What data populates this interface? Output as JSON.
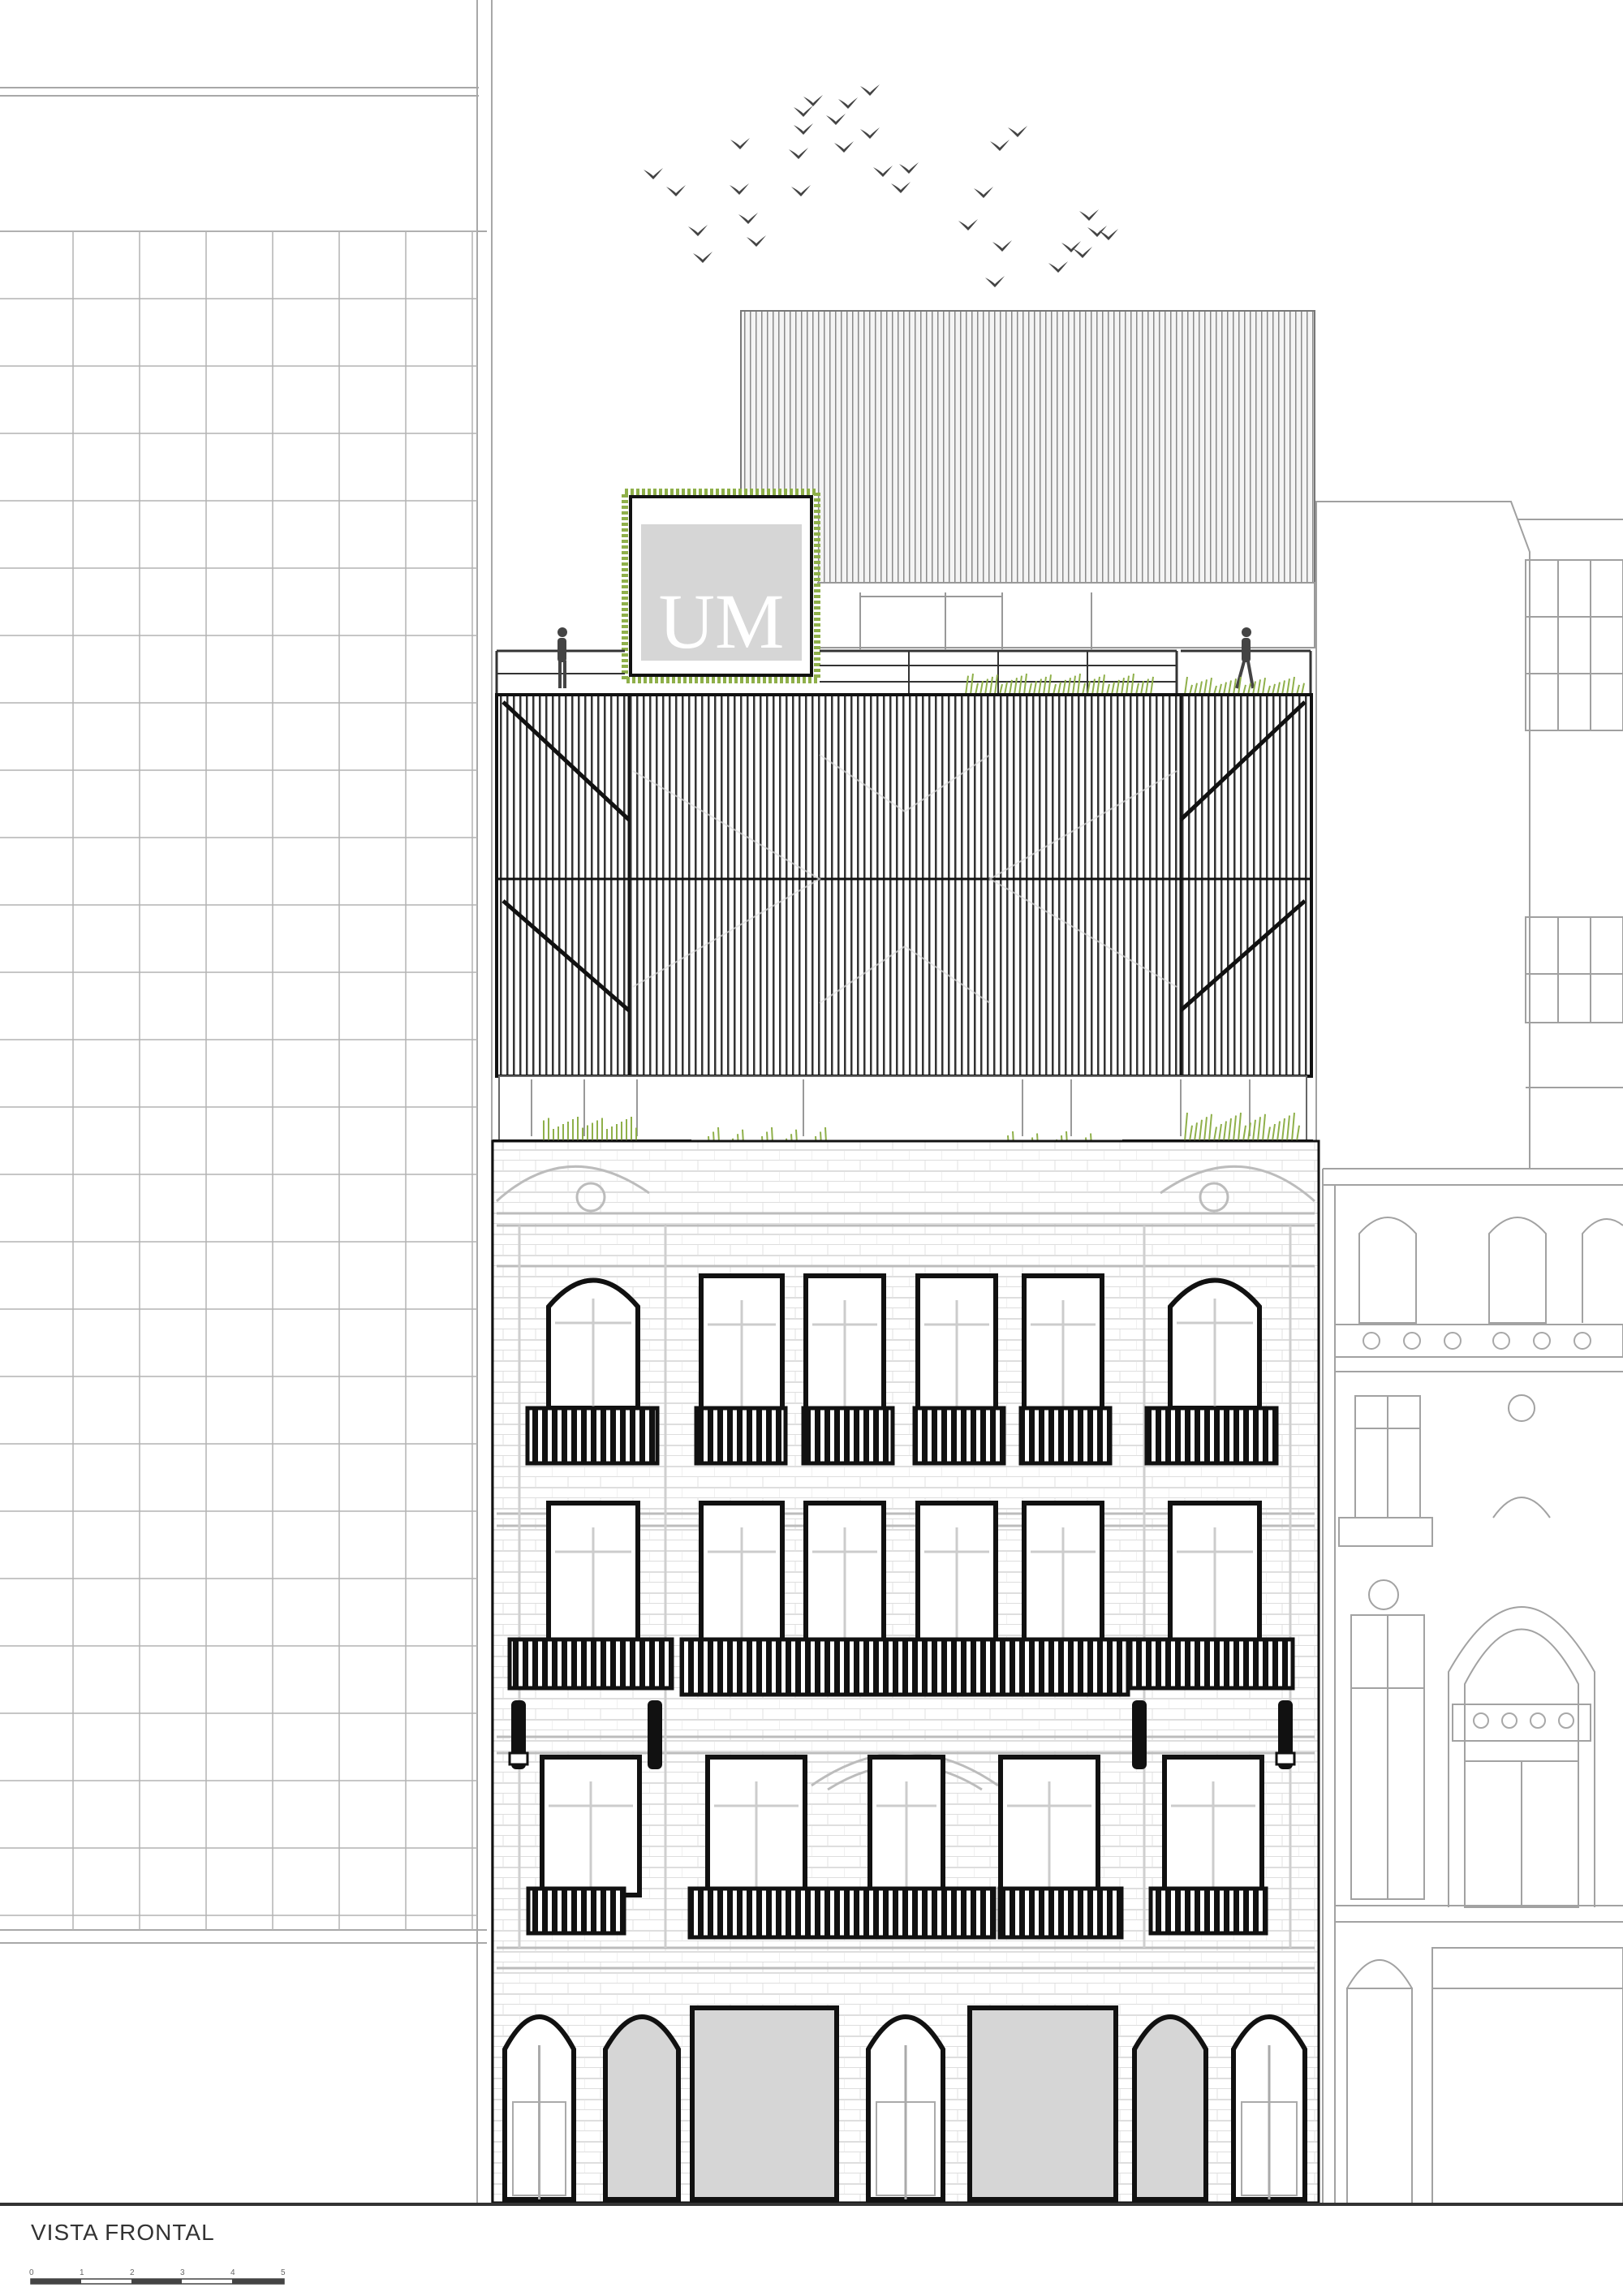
{
  "drawing_title": "VISTA FRONTAL",
  "sign": {
    "text": "UM"
  },
  "scale_bar": {
    "ticks": [
      "0",
      "1",
      "2",
      "3",
      "4",
      "5"
    ]
  },
  "colors": {
    "line": "#9a9a9a",
    "dark": "#1a1a1a",
    "fill_light": "#d6d6d6",
    "grass": "#8fb04a"
  }
}
